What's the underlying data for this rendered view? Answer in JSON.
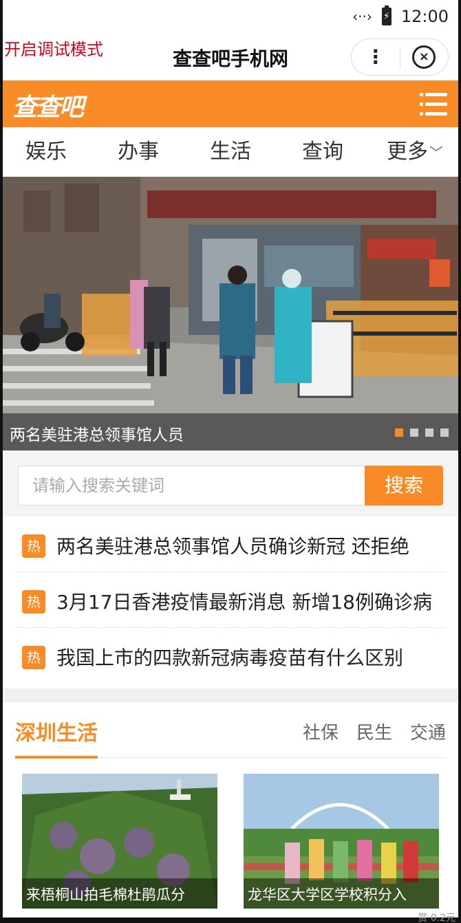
{
  "status_bar": {
    "time": "12:00",
    "signal_icon": "data-signal-icon",
    "battery_icon": "battery-charging-icon"
  },
  "title_bar": {
    "debug_label": "开启调试模式",
    "title": "查查吧手机网",
    "more_icon": "more-dots-icon",
    "close_icon": "close-circle-icon"
  },
  "header": {
    "logo_text": "查查吧",
    "brand_color": "#f88b25",
    "menu_icon": "menu-list-icon"
  },
  "categories": [
    {
      "label": "娱乐"
    },
    {
      "label": "办事"
    },
    {
      "label": "生活"
    },
    {
      "label": "查询"
    },
    {
      "label": "更多"
    }
  ],
  "banner": {
    "caption": "两名美驻港总领事馆人员",
    "slide_count": 4,
    "active_slide": 1
  },
  "search": {
    "placeholder": "请输入搜索关键词",
    "button_label": "搜索"
  },
  "hot_news": [
    {
      "badge": "热",
      "text": "两名美驻港总领事馆人员确诊新冠 还拒绝"
    },
    {
      "badge": "热",
      "text": "3月17日香港疫情最新消息 新增18例确诊病"
    },
    {
      "badge": "热",
      "text": "我国上市的四款新冠病毒疫苗有什么区别"
    }
  ],
  "section": {
    "title": "深圳生活",
    "tabs": [
      {
        "label": "社保"
      },
      {
        "label": "民生"
      },
      {
        "label": "交通"
      }
    ],
    "cards": [
      {
        "caption": "来梧桐山拍毛棉杜鹃瓜分"
      },
      {
        "caption": "龙华区大学区学校积分入"
      }
    ]
  },
  "footer_partial": "赏 0.2元"
}
